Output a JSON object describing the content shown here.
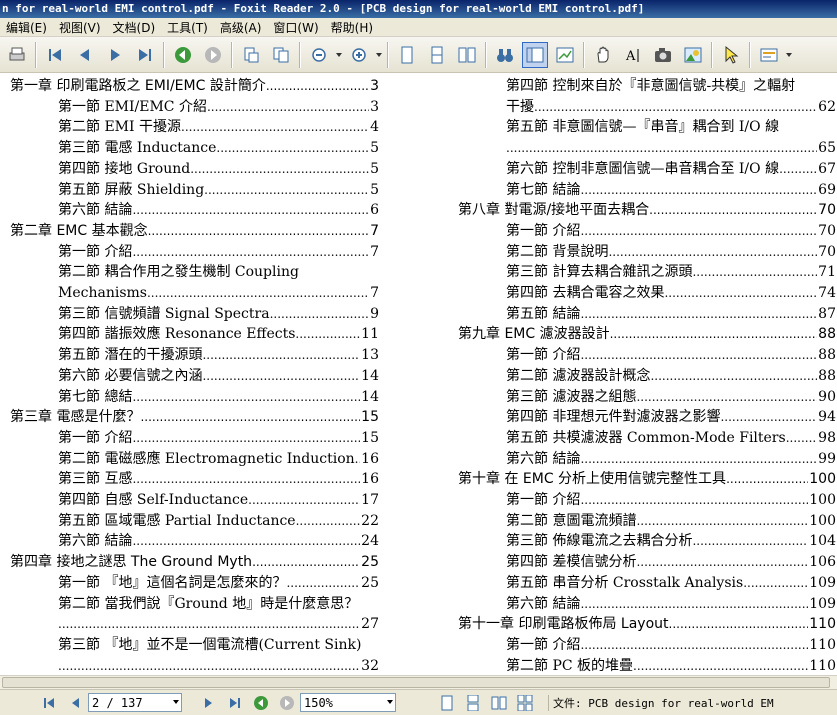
{
  "window": {
    "title": "n for real-world EMI control.pdf - Foxit Reader 2.0 - [PCB design for real-world EMI control.pdf]"
  },
  "menu": {
    "items": [
      "编辑(E)",
      "视图(V)",
      "文档(D)",
      "工具(T)",
      "高级(A)",
      "窗口(W)",
      "帮助(H)"
    ]
  },
  "toolbar": {
    "icons": [
      "print-icon",
      "first-page-icon",
      "prev-page-icon",
      "next-page-icon",
      "last-page-icon",
      "go-back-icon",
      "go-forward-icon",
      "rotate-icon",
      "copy-icon",
      "zoom-out-icon",
      "zoom-in-icon",
      "single-page-icon",
      "continuous-icon",
      "facing-icon",
      "binoculars-icon",
      "bookmark-panel-icon",
      "thumbnail-icon",
      "hand-tool-icon",
      "text-select-icon",
      "snapshot-icon",
      "image-tool-icon",
      "pointer-icon",
      "annotation-icon"
    ]
  },
  "toc_left": [
    {
      "kind": "chapter",
      "text": "第一章  印刷電路板之 EMI/EMC 設計簡介",
      "page": "3"
    },
    {
      "kind": "section",
      "text": "第一節  EMI/EMC 介紹",
      "page": "3"
    },
    {
      "kind": "section",
      "text": "第二節  EMI 干擾源",
      "page": "4"
    },
    {
      "kind": "section",
      "text": "第三節  電感 Inductance",
      "page": "5"
    },
    {
      "kind": "section",
      "text": "第四節  接地 Ground",
      "page": "5"
    },
    {
      "kind": "section",
      "text": "第五節  屏蔽 Shielding",
      "page": "5"
    },
    {
      "kind": "section",
      "text": "第六節  結論",
      "page": "6"
    },
    {
      "kind": "chapter",
      "text": "第二章  EMC 基本觀念",
      "page": "7"
    },
    {
      "kind": "section",
      "text": "第一節  介紹",
      "page": "7"
    },
    {
      "kind": "section-wrap",
      "text": "第二節  耦合作用之發生機制 Coupling",
      "page": ""
    },
    {
      "kind": "cont",
      "text": "Mechanisms",
      "page": "7"
    },
    {
      "kind": "section",
      "text": "第三節  信號頻譜 Signal Spectra",
      "page": "9"
    },
    {
      "kind": "section",
      "text": "第四節  諧振效應 Resonance Effects",
      "page": "11"
    },
    {
      "kind": "section",
      "text": "第五節  潛在的干擾源頭",
      "page": "13"
    },
    {
      "kind": "section",
      "text": "第六節  必要信號之內涵",
      "page": "14"
    },
    {
      "kind": "section",
      "text": "第七節  總結",
      "page": "14"
    },
    {
      "kind": "chapter",
      "text": "第三章  電感是什麼？",
      "page": "15"
    },
    {
      "kind": "section",
      "text": "第一節  介紹",
      "page": "15"
    },
    {
      "kind": "section",
      "text": "第二節  電磁感應 Electromagnetic Induction",
      "page": "16"
    },
    {
      "kind": "section",
      "text": "第三節  互感",
      "page": "16"
    },
    {
      "kind": "section",
      "text": "第四節  自感 Self-Inductance",
      "page": "17"
    },
    {
      "kind": "section",
      "text": "第五節  區域電感 Partial Inductance",
      "page": "22"
    },
    {
      "kind": "section",
      "text": "第六節  結論",
      "page": "24"
    },
    {
      "kind": "chapter",
      "text": "第四章  接地之謎思 The Ground Myth",
      "page": "25"
    },
    {
      "kind": "section",
      "text": "第一節  『地』這個名詞是怎麼來的？",
      "page": "25"
    },
    {
      "kind": "section-wrap",
      "text": "第二節  當我們說『Ground 地』時是什麼意思？",
      "page": ""
    },
    {
      "kind": "cont-dots",
      "text": "",
      "page": "27"
    },
    {
      "kind": "section-wrap",
      "text": "第三節  『地』並不是一個電流槽(Current Sink)",
      "page": ""
    },
    {
      "kind": "cont-dots",
      "text": "",
      "page": "32"
    }
  ],
  "toc_right": [
    {
      "kind": "section-wrap",
      "text": "第四節  控制來自於『非意圖信號-共模』之輻射",
      "page": ""
    },
    {
      "kind": "cont",
      "text": "干擾",
      "page": "62"
    },
    {
      "kind": "section-wrap",
      "text": "第五節    非意圖信號—『串音』耦合到 I/O 線",
      "page": ""
    },
    {
      "kind": "cont-dots",
      "text": "",
      "page": "65"
    },
    {
      "kind": "section",
      "text": "第六節  控制非意圖信號—串音耦合至 I/O 線",
      "page": "67"
    },
    {
      "kind": "section",
      "text": "第七節  結論",
      "page": "69"
    },
    {
      "kind": "chapter",
      "text": "第八章  對電源/接地平面去耦合",
      "page": "70"
    },
    {
      "kind": "section",
      "text": "第一節  介紹",
      "page": "70"
    },
    {
      "kind": "section",
      "text": "第二節  背景說明",
      "page": "70"
    },
    {
      "kind": "section",
      "text": "第三節  計算去耦合雜訊之源頭",
      "page": "71"
    },
    {
      "kind": "section",
      "text": "第四節  去耦合電容之效果",
      "page": "74"
    },
    {
      "kind": "section",
      "text": "第五節  結論",
      "page": "87"
    },
    {
      "kind": "chapter",
      "text": "第九章  EMC 濾波器設計",
      "page": "88"
    },
    {
      "kind": "section",
      "text": "第一節  介紹",
      "page": "88"
    },
    {
      "kind": "section",
      "text": "第二節  濾波器設計概念",
      "page": "88"
    },
    {
      "kind": "section",
      "text": "第三節  濾波器之組態",
      "page": "90"
    },
    {
      "kind": "section",
      "text": "第四節  非理想元件對濾波器之影響",
      "page": "94"
    },
    {
      "kind": "section",
      "text": "第五節  共模濾波器 Common-Mode Filters",
      "page": "98"
    },
    {
      "kind": "section",
      "text": "第六節  結論",
      "page": "99"
    },
    {
      "kind": "chapter",
      "text": "第十章  在 EMC 分析上使用信號完整性工具",
      "page": "100"
    },
    {
      "kind": "section",
      "text": "第一節  介紹",
      "page": "100"
    },
    {
      "kind": "section",
      "text": "第二節  意圖電流頻譜",
      "page": "100"
    },
    {
      "kind": "section",
      "text": "第三節  佈線電流之去耦合分析",
      "page": "104"
    },
    {
      "kind": "section",
      "text": "第四節  差模信號分析",
      "page": "106"
    },
    {
      "kind": "section",
      "text": "第五節  串音分析 Crosstalk Analysis",
      "page": "109"
    },
    {
      "kind": "section",
      "text": "第六節  結論",
      "page": "109"
    },
    {
      "kind": "chapter",
      "text": "第十一章  印刷電路板佈局 Layout",
      "page": "110"
    },
    {
      "kind": "section",
      "text": "第一節  介紹",
      "page": "110"
    },
    {
      "kind": "section",
      "text": "第二節  PC 板的堆疊",
      "page": "110"
    }
  ],
  "status": {
    "page_field": "2 / 137",
    "zoom_field": "150%",
    "file_text": "文件: PCB design for real-world EM"
  }
}
